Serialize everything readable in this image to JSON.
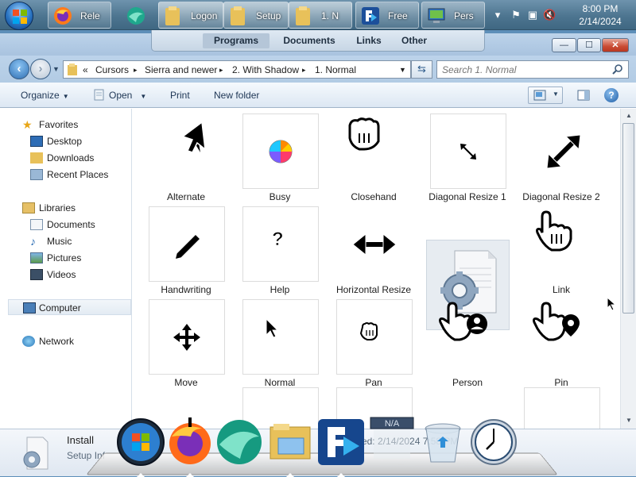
{
  "taskbar": {
    "buttons": [
      {
        "label": "Rele",
        "icon": "firefox-icon"
      },
      {
        "label": "",
        "icon": "app-globe-icon"
      },
      {
        "label": "Logon",
        "icon": "folder-icon"
      },
      {
        "label": "Setup",
        "icon": "folder-icon"
      },
      {
        "label": "1. N",
        "icon": "folder-icon"
      },
      {
        "label": "Free",
        "icon": "app-arrow-icon"
      },
      {
        "label": "Pers",
        "icon": "control-panel-icon"
      }
    ],
    "clock_time": "8:00 PM",
    "clock_date": "2/14/2024"
  },
  "jump_tabs": [
    "Programs",
    "Documents",
    "Links",
    "Other"
  ],
  "window": {
    "caption_buttons": {
      "minimize": "—",
      "maximize": "☐",
      "close": "✕"
    },
    "breadcrumb": [
      "«",
      "Cursors",
      "Sierra and newer",
      "2. With Shadow",
      "1. Normal"
    ],
    "search_placeholder": "Search 1. Normal",
    "commands": {
      "organize": "Organize",
      "open": "Open",
      "print": "Print",
      "new_folder": "New folder"
    }
  },
  "nav": {
    "favorites": {
      "label": "Favorites",
      "items": [
        "Desktop",
        "Downloads",
        "Recent Places"
      ]
    },
    "libraries": {
      "label": "Libraries",
      "items": [
        "Documents",
        "Music",
        "Pictures",
        "Videos"
      ]
    },
    "computer": "Computer",
    "network": "Network"
  },
  "files": [
    {
      "name": "Alternate",
      "icon": "alternate-cursor-icon",
      "boxed": false
    },
    {
      "name": "Busy",
      "icon": "busy-cursor-icon",
      "boxed": true
    },
    {
      "name": "Closehand",
      "icon": "closehand-cursor-icon",
      "boxed": false
    },
    {
      "name": "Diagonal Resize 1",
      "icon": "diagonal-resize-1-cursor-icon",
      "boxed": true
    },
    {
      "name": "Diagonal Resize 2",
      "icon": "diagonal-resize-2-cursor-icon",
      "boxed": false
    },
    {
      "name": "Handwriting",
      "icon": "handwriting-cursor-icon",
      "boxed": true
    },
    {
      "name": "Help",
      "icon": "help-cursor-icon",
      "boxed": true
    },
    {
      "name": "Horizontal Resize",
      "icon": "horizontal-resize-cursor-icon",
      "boxed": false
    },
    {
      "name": "Install",
      "icon": "install-file-icon",
      "boxed": false
    },
    {
      "name": "Link",
      "icon": "link-cursor-icon",
      "boxed": false
    },
    {
      "name": "Move",
      "icon": "move-cursor-icon",
      "boxed": true
    },
    {
      "name": "Normal",
      "icon": "normal-cursor-icon",
      "boxed": true
    },
    {
      "name": "Pan",
      "icon": "pan-cursor-icon",
      "boxed": true
    },
    {
      "name": "Person",
      "icon": "person-cursor-icon",
      "boxed": false
    },
    {
      "name": "Pin",
      "icon": "pin-cursor-icon",
      "boxed": false
    }
  ],
  "details": {
    "name": "Install",
    "type": "Setup Inf",
    "modified": "ed: 2/14/2024 7:58 PM"
  },
  "dock": {
    "apps": [
      "windows-start-icon",
      "firefox-icon",
      "app-globe-icon",
      "explorer-folder-icon",
      "app-arrow-icon",
      "na-icon",
      "recycle-bin-icon",
      "clock-icon"
    ],
    "na_label": "N/A"
  }
}
